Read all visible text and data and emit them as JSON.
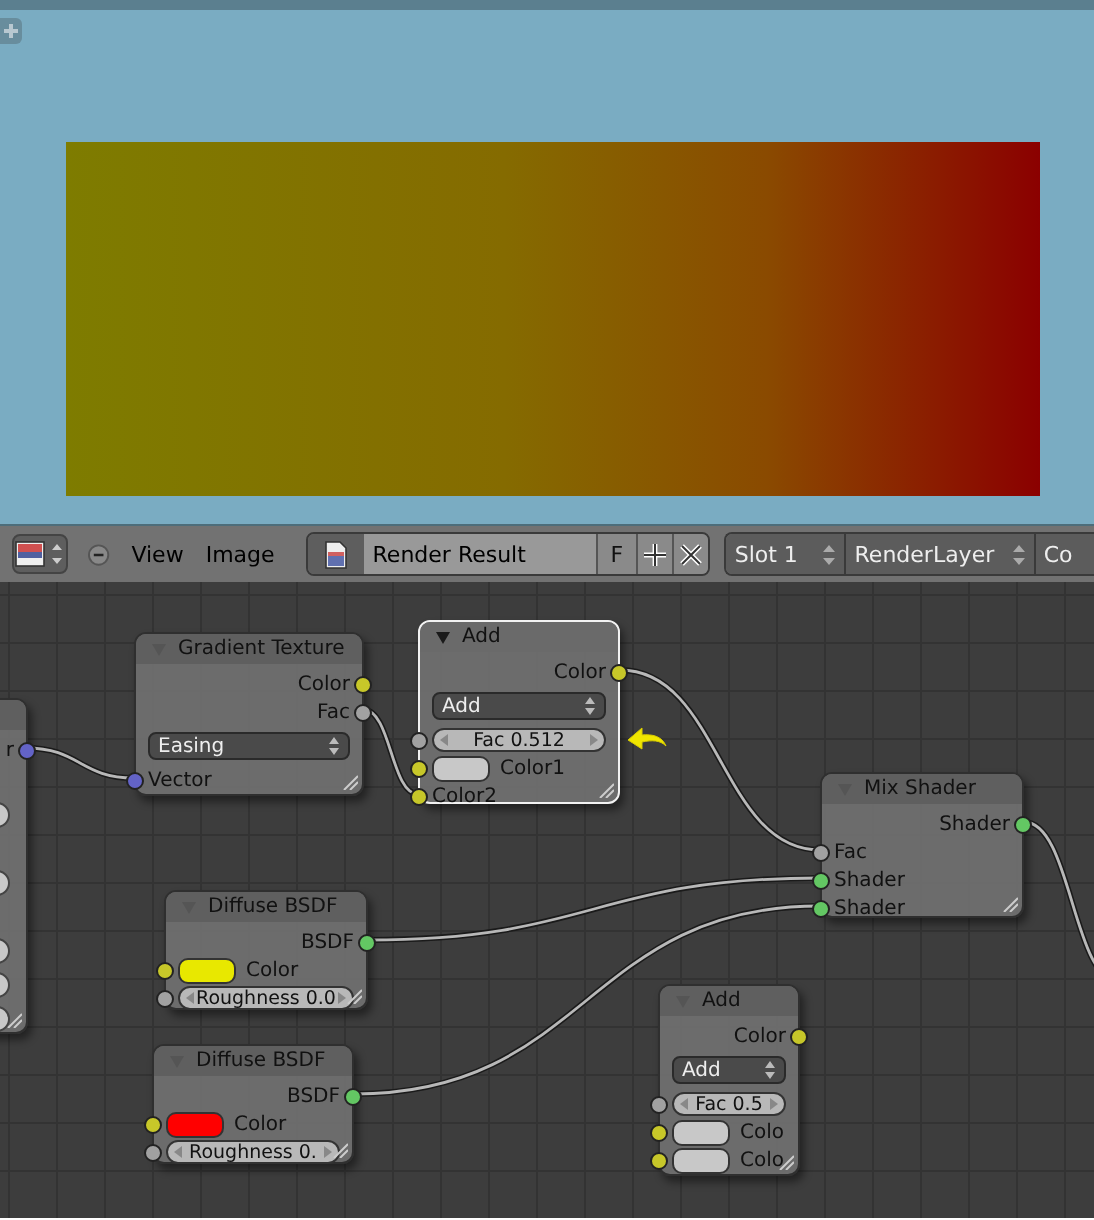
{
  "header": {
    "menus": [
      "View",
      "Image"
    ],
    "image_name": "Render Result",
    "fake_user": "F",
    "slot": "Slot 1",
    "layer": "RenderLayer",
    "cut_dropdown": "Co"
  },
  "nodes": [
    {
      "selected": false,
      "rows": [
        {
          "kind": "output",
          "label": "r",
          "socket": {
            "color": "#6363c7"
          }
        },
        {
          "kind": "stub"
        },
        {
          "kind": "stub"
        },
        {
          "kind": "stub"
        },
        {
          "kind": "stub"
        },
        {
          "kind": "stub"
        }
      ]
    },
    {
      "title": "Gradient Texture",
      "selected": false,
      "rows": [
        {
          "kind": "output",
          "label": "Color",
          "socket": {
            "color": "#c7c729"
          }
        },
        {
          "kind": "output",
          "label": "Fac",
          "socket": {
            "color": "#a1a1a1"
          }
        },
        {
          "kind": "dropdown",
          "value": "Easing"
        },
        {
          "kind": "input",
          "label": "Vector",
          "socket": {
            "color": "#6363c7"
          }
        }
      ]
    },
    {
      "title": "Add",
      "selected": true,
      "rows": [
        {
          "kind": "output",
          "label": "Color",
          "socket": {
            "color": "#c7c729"
          }
        },
        {
          "kind": "dropdown",
          "value": "Add"
        },
        {
          "kind": "slider",
          "value": "Fac 0.512",
          "socket": {
            "color": "#a1a1a1"
          }
        },
        {
          "kind": "swatch",
          "label": "Color1",
          "color": "#c8c8c8",
          "socket": {
            "color": "#c7c729"
          }
        },
        {
          "kind": "input",
          "label": "Color2",
          "socket": {
            "color": "#c7c729"
          }
        }
      ]
    },
    {
      "title": "Mix Shader",
      "selected": false,
      "rows": [
        {
          "kind": "output",
          "label": "Shader",
          "socket": {
            "color": "#63c763"
          }
        },
        {
          "kind": "input",
          "label": "Fac",
          "socket": {
            "color": "#a1a1a1"
          }
        },
        {
          "kind": "input",
          "label": "Shader",
          "socket": {
            "color": "#63c763"
          }
        },
        {
          "kind": "input",
          "label": "Shader",
          "socket": {
            "color": "#63c763"
          }
        }
      ]
    },
    {
      "title": "Diffuse BSDF",
      "selected": false,
      "rows": [
        {
          "kind": "output",
          "label": "BSDF",
          "socket": {
            "color": "#63c763"
          }
        },
        {
          "kind": "swatch",
          "label": "Color",
          "color": "#e8e800",
          "socket": {
            "color": "#c7c729"
          }
        },
        {
          "kind": "slider",
          "value": "Roughness 0.0",
          "socket": {
            "color": "#a1a1a1"
          }
        }
      ]
    },
    {
      "title": "Diffuse BSDF",
      "selected": false,
      "rows": [
        {
          "kind": "output",
          "label": "BSDF",
          "socket": {
            "color": "#63c763"
          }
        },
        {
          "kind": "swatch",
          "label": "Color",
          "color": "#ff0000",
          "socket": {
            "color": "#c7c729"
          }
        },
        {
          "kind": "slider",
          "value": "Roughness 0.",
          "socket": {
            "color": "#a1a1a1"
          }
        }
      ]
    },
    {
      "title": "Add",
      "selected": false,
      "rows": [
        {
          "kind": "output",
          "label": "Color",
          "socket": {
            "color": "#c7c729"
          }
        },
        {
          "kind": "dropdown",
          "value": "Add"
        },
        {
          "kind": "slider",
          "value": "Fac 0.5",
          "socket": {
            "color": "#a1a1a1"
          }
        },
        {
          "kind": "swatch",
          "label": "Colo",
          "color": "#c8c8c8",
          "socket": {
            "color": "#c7c729"
          }
        },
        {
          "kind": "swatch",
          "label": "Colo",
          "color": "#c8c8c8",
          "socket": {
            "color": "#c7c729"
          }
        }
      ]
    }
  ]
}
